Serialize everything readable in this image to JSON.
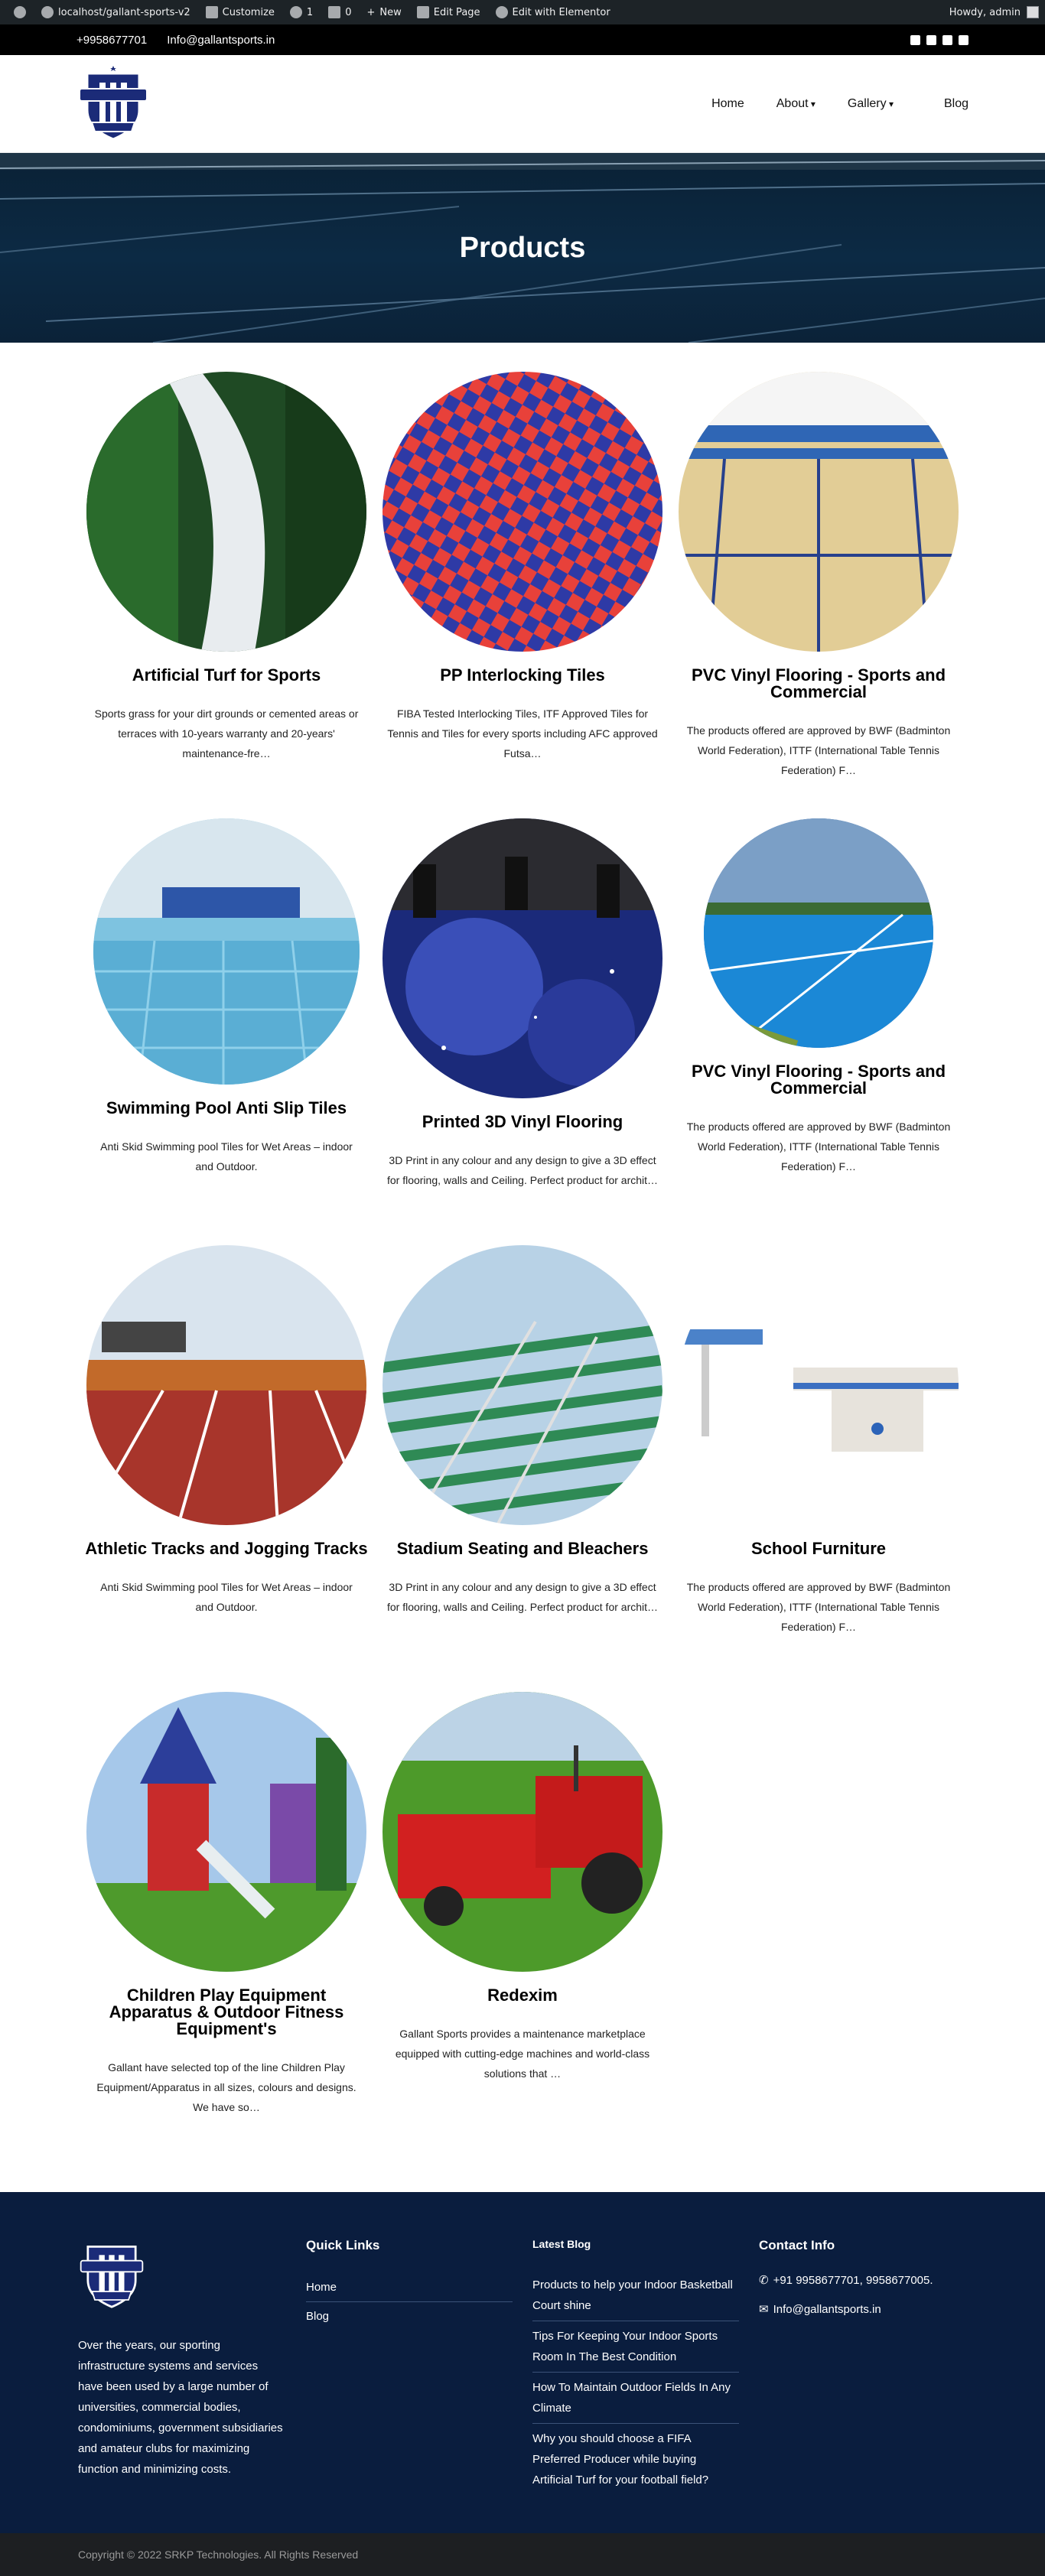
{
  "adminbar": {
    "site": "localhost/gallant-sports-v2",
    "customize": "Customize",
    "updates": "1",
    "comments": "0",
    "new": "New",
    "edit_page": "Edit Page",
    "elementor": "Edit with Elementor",
    "howdy": "Howdy, admin"
  },
  "topbar": {
    "phone": "+9958677701",
    "email": "Info@gallantsports.in"
  },
  "nav": {
    "home": "Home",
    "about": "About",
    "gallery": "Gallery",
    "blog": "Blog"
  },
  "hero": {
    "title": "Products"
  },
  "products": [
    {
      "title": "Artificial Turf for Sports",
      "desc": "Sports grass for your dirt grounds or cemented areas or terraces with 10-years warranty and 20-years' maintenance-fre…"
    },
    {
      "title": "PP Interlocking Tiles",
      "desc": "FIBA Tested Interlocking Tiles, ITF Approved Tiles for Tennis and Tiles for every sports including AFC approved Futsa…"
    },
    {
      "title": "PVC Vinyl Flooring - Sports and Commercial",
      "desc": "The products offered are approved by BWF (Badminton World Federation), ITTF (International Table Tennis Federation) F…"
    },
    {
      "title": "Swimming Pool Anti Slip Tiles",
      "desc": "Anti Skid Swimming pool Tiles for Wet Areas – indoor and Outdoor."
    },
    {
      "title": "Printed 3D Vinyl Flooring",
      "desc": "3D Print in any colour and any design to give a 3D effect for flooring, walls and Ceiling. Perfect product for archit…"
    },
    {
      "title": "PVC Vinyl Flooring - Sports and Commercial",
      "desc": "The products offered are approved by BWF (Badminton World Federation), ITTF (International Table Tennis Federation) F…"
    },
    {
      "title": "Athletic Tracks and Jogging Tracks",
      "desc": "Anti Skid Swimming pool Tiles for Wet Areas – indoor and Outdoor."
    },
    {
      "title": "Stadium Seating and Bleachers",
      "desc": "3D Print in any colour and any design to give a 3D effect for flooring, walls and Ceiling. Perfect product for archit…"
    },
    {
      "title": "School Furniture",
      "desc": "The products offered are approved by BWF (Badminton World Federation), ITTF (International Table Tennis Federation) F…"
    },
    {
      "title": "Children Play Equipment Apparatus & Outdoor Fitness Equipment's",
      "desc": "Gallant have selected top of the line Children Play Equipment/Apparatus in all sizes, colours and designs. We have so…"
    },
    {
      "title": "Redexim",
      "desc": "Gallant Sports provides a maintenance marketplace equipped with cutting-edge machines and world-class solutions that …"
    }
  ],
  "footer": {
    "about": "Over the years, our sporting infrastructure systems and services have been used by a large number of universities, commercial bodies, condominiums, government subsidiaries and amateur clubs for maximizing function and minimizing costs.",
    "quick_links_title": "Quick Links",
    "quick_links": [
      "Home",
      "Blog"
    ],
    "latest_blog_title": "Latest Blog",
    "latest_blog": [
      "Products to help your Indoor Basketball Court shine",
      "Tips For Keeping Your Indoor Sports Room In The Best Condition",
      "How To Maintain Outdoor Fields In Any Climate",
      "Why you should choose a FIFA Preferred Producer while buying Artificial Turf for your football field?"
    ],
    "contact_title": "Contact Info",
    "contact_phone": "+91 9958677701, 9958677005.",
    "contact_email": "Info@gallantsports.in",
    "copyright": "Copyright © 2022 SRKP Technologies. All Rights Reserved"
  },
  "colors": {
    "footer_bg": "#0a1d3e",
    "hero_bg": "#0c2a44",
    "topbar_bg": "#000000",
    "adminbar_bg": "#1d2327"
  }
}
